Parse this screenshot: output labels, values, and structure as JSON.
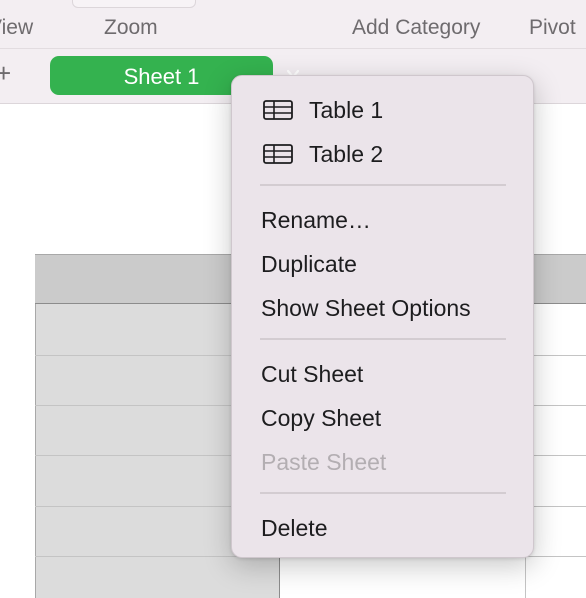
{
  "toolbar": {
    "items": [
      {
        "label": "View"
      },
      {
        "label": "Zoom"
      },
      {
        "label": "Add Category"
      },
      {
        "label": "Pivot"
      }
    ]
  },
  "tabbar": {
    "add_icon": "plus-icon",
    "active_sheet": {
      "label": "Sheet 1",
      "chevron_icon": "chevron-down-icon",
      "color": "#34b24f"
    }
  },
  "context_menu": {
    "tables": [
      {
        "label": "Table 1",
        "icon": "table-icon"
      },
      {
        "label": "Table 2",
        "icon": "table-icon"
      }
    ],
    "group1": [
      {
        "label": "Rename…"
      },
      {
        "label": "Duplicate"
      },
      {
        "label": "Show Sheet Options"
      }
    ],
    "group2": [
      {
        "label": "Cut Sheet",
        "enabled": true
      },
      {
        "label": "Copy Sheet",
        "enabled": true
      },
      {
        "label": "Paste Sheet",
        "enabled": false
      }
    ],
    "group3": [
      {
        "label": "Delete"
      }
    ]
  }
}
